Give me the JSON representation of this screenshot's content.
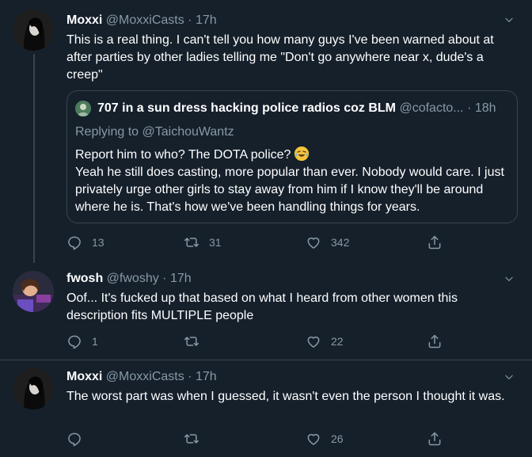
{
  "tweets": [
    {
      "name": "Moxxi",
      "handle": "@MoxxiCasts",
      "sep": "·",
      "time": "17h",
      "text": "This is a real thing.  I can't tell you how many guys I've been warned about at after parties by other ladies telling me \"Don't go anywhere near x, dude's a creep\"",
      "quote": {
        "name": "707 in a sun dress hacking police radios coz BLM",
        "handle": "@cofacto...",
        "sep": "·",
        "time": "18h",
        "replying_prefix": "Replying to",
        "replying_to": "@TaichouWantz",
        "line1": "Report him to who? The DOTA police?",
        "line2": "Yeah he still does casting, more popular than ever. Nobody would care. I just privately urge other girls to stay away from him if I know they'll be around where he is. That's how we've been handling things for years."
      },
      "replies": "13",
      "retweets": "31",
      "likes": "342"
    },
    {
      "name": "fwosh",
      "handle": "@fwoshy",
      "sep": "·",
      "time": "17h",
      "text": "Oof... It's fucked up that based on what I heard from other women this description fits MULTIPLE people",
      "replies": "1",
      "retweets": "",
      "likes": "22"
    },
    {
      "name": "Moxxi",
      "handle": "@MoxxiCasts",
      "sep": "·",
      "time": "17h",
      "text": "The worst part was when I guessed, it wasn't even the person I thought it was.",
      "replies": "",
      "retweets": "",
      "likes": "26"
    }
  ],
  "colors": {
    "background": "#15202b",
    "secondary_text": "#8899a6",
    "border": "#38444d"
  }
}
